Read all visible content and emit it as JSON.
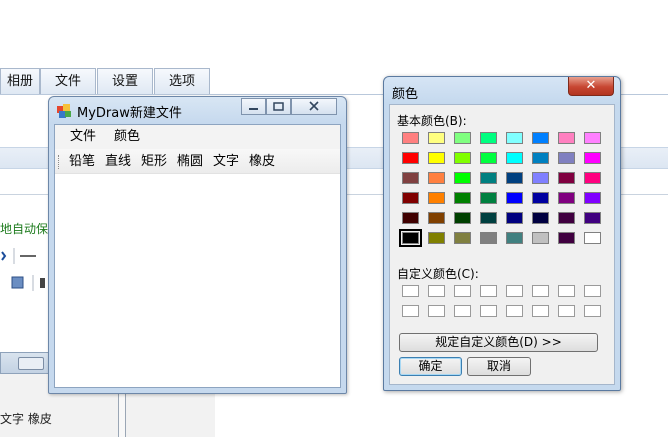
{
  "background": {
    "tabs": [
      "相册",
      "文件",
      "设置",
      "选项"
    ],
    "green_text": "地自动保存",
    "lower_text": "文字  橡皮"
  },
  "mydraw": {
    "title": "MyDraw新建文件",
    "menu": [
      "文件",
      "颜色"
    ],
    "tools": [
      "铅笔",
      "直线",
      "矩形",
      "椭圆",
      "文字",
      "橡皮"
    ]
  },
  "color_dialog": {
    "title": "颜色",
    "close_glyph": "✕",
    "basic_label": "基本颜色(B):",
    "custom_label": "自定义颜色(C):",
    "define_button": "规定自定义颜色(D) >>",
    "ok_button": "确定",
    "cancel_button": "取消",
    "selected_color": "#000000",
    "basic_colors": [
      [
        "#ff8080",
        "#ffff80",
        "#80ff80",
        "#00ff80",
        "#80ffff",
        "#0080ff",
        "#ff80c0",
        "#ff80ff"
      ],
      [
        "#ff0000",
        "#ffff00",
        "#80ff00",
        "#00ff40",
        "#00ffff",
        "#0080c0",
        "#8080c0",
        "#ff00ff"
      ],
      [
        "#804040",
        "#ff8040",
        "#00ff00",
        "#008080",
        "#004080",
        "#8080ff",
        "#800040",
        "#ff0080"
      ],
      [
        "#800000",
        "#ff8000",
        "#008000",
        "#008040",
        "#0000ff",
        "#0000a0",
        "#800080",
        "#8000ff"
      ],
      [
        "#400000",
        "#804000",
        "#004000",
        "#004040",
        "#000080",
        "#000040",
        "#400040",
        "#400080"
      ],
      [
        "#000000",
        "#808000",
        "#808040",
        "#808080",
        "#408080",
        "#c0c0c0",
        "#400040",
        "#ffffff"
      ]
    ]
  }
}
